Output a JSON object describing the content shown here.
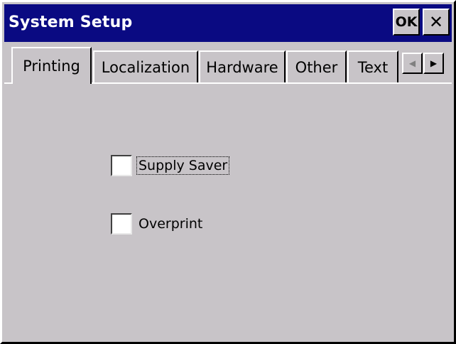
{
  "window": {
    "title": "System Setup",
    "ok_label": "OK",
    "close_label": "✕"
  },
  "tabs": [
    {
      "label": "Printing",
      "active": true
    },
    {
      "label": "Localization",
      "active": false
    },
    {
      "label": "Hardware",
      "active": false
    },
    {
      "label": "Other",
      "active": false
    },
    {
      "label": "Text",
      "active": false
    }
  ],
  "tab_scroll": {
    "left_icon": "◀",
    "right_icon": "▶"
  },
  "options": [
    {
      "label": "Supply Saver",
      "checked": false,
      "focused": true
    },
    {
      "label": "Overprint",
      "checked": false,
      "focused": false
    }
  ]
}
